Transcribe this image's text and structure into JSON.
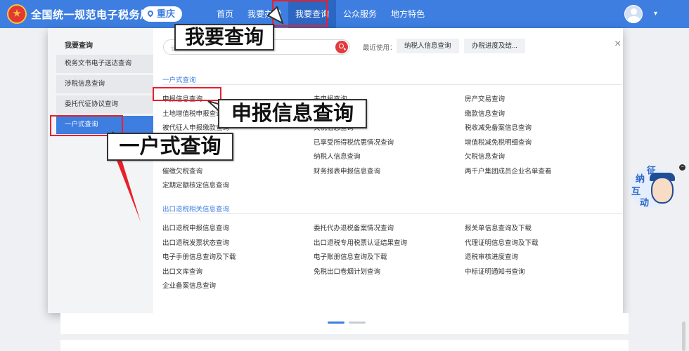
{
  "header": {
    "site_title": "全国统一规范电子税务局",
    "city": "重庆",
    "nav": [
      "首页",
      "我要办税",
      "我要查询",
      "公众服务",
      "地方特色"
    ],
    "user_menu_chevron": "▾"
  },
  "sidebar": {
    "title": "我要查询",
    "items": [
      "税务文书电子送达查询",
      "涉税信息查询",
      "委托代征协议查询",
      "一户式查询"
    ]
  },
  "search": {
    "placeholder": "请",
    "recent_label": "最近使用：",
    "recent": [
      "纳税人信息查询",
      "办税进度及结..."
    ]
  },
  "close_symbol": "×",
  "sections": [
    {
      "title": "一户式查询",
      "links": [
        [
          "申报信息查询",
          "未申报查询",
          "房产交易查询"
        ],
        [
          "土地增值税申报查询",
          "",
          "缴款信息查询"
        ],
        [
          "被代征人申报缴款查询",
          "欠税信息查询",
          "税收减免备案信息查询"
        ],
        [
          "",
          "已享受所得税优惠情况查询",
          "增值税减免税明细查询"
        ],
        [
          "",
          "纳税人信息查询",
          "欠税信息查询"
        ],
        [
          "催缴欠税查询",
          "财务报表申报信息查询",
          "两千户集团成员企业名单查看"
        ],
        [
          "定期定额核定信息查询",
          "",
          ""
        ]
      ]
    },
    {
      "title": "出口退税相关信息查询",
      "links": [
        [
          "出口退税申报信息查询",
          "委托代办退税备案情况查询",
          "报关单信息查询及下载"
        ],
        [
          "出口退税发票状态查询",
          "出口退税专用税票认证结果查询",
          "代理证明信息查询及下载"
        ],
        [
          "电子手册信息查询及下载",
          "电子账册信息查询及下载",
          "退税审核进度查询"
        ],
        [
          "出口文库查询",
          "免税出口卷烟计划查询",
          "中标证明通知书查询"
        ],
        [
          "企业备案信息查询",
          "",
          ""
        ]
      ]
    }
  ],
  "callouts": [
    "我要查询",
    "申报信息查询",
    "一户式查询"
  ],
  "assistant": {
    "chars": [
      "征",
      "纳",
      "互",
      "动"
    ],
    "close": "−"
  },
  "colors": {
    "primary": "#3d7ee0",
    "highlight": "#e8202a",
    "search_button": "#e6393c"
  }
}
